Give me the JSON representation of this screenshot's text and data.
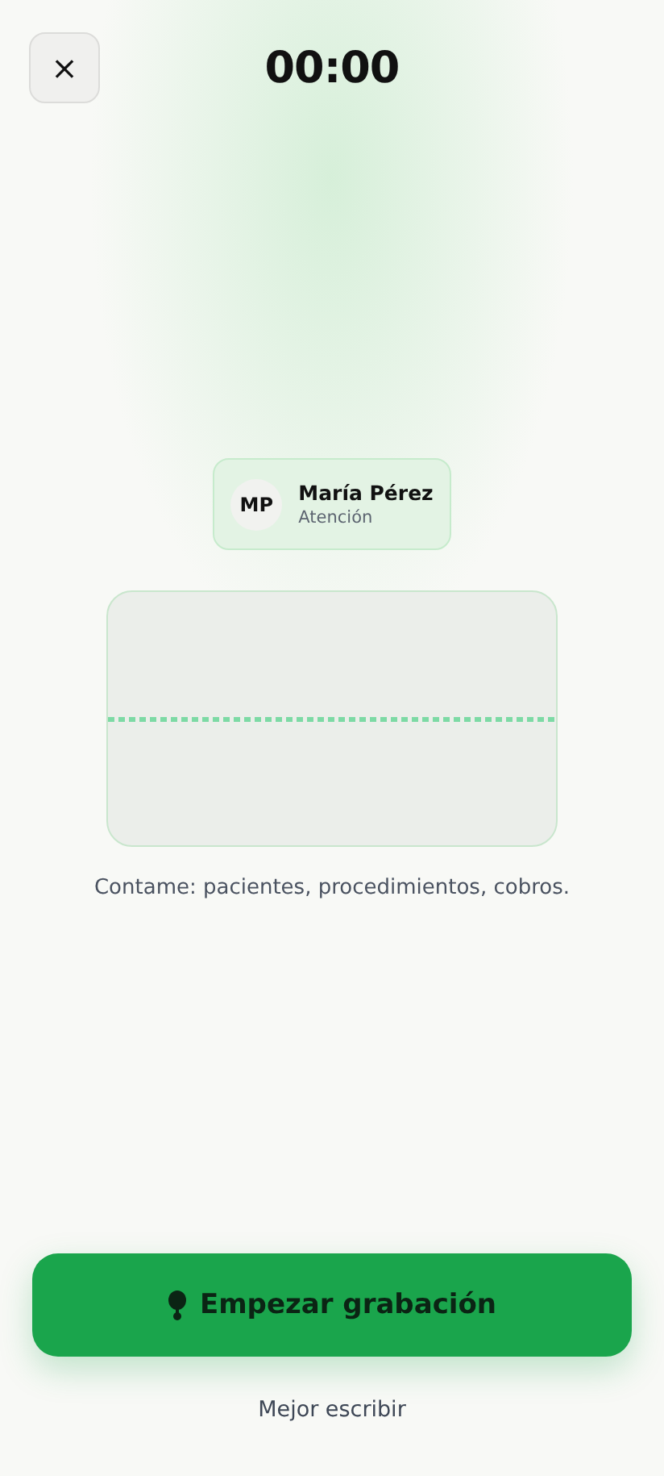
{
  "header": {
    "close": "×",
    "timer": "00:00"
  },
  "patient": {
    "initials": "MP",
    "name": "María Pérez",
    "role": "Atención"
  },
  "prompt": "Contame: pacientes, procedimientos, cobros.",
  "record_button": {
    "label": "Empezar grabación"
  },
  "alt_link": "Mejor escribir"
}
